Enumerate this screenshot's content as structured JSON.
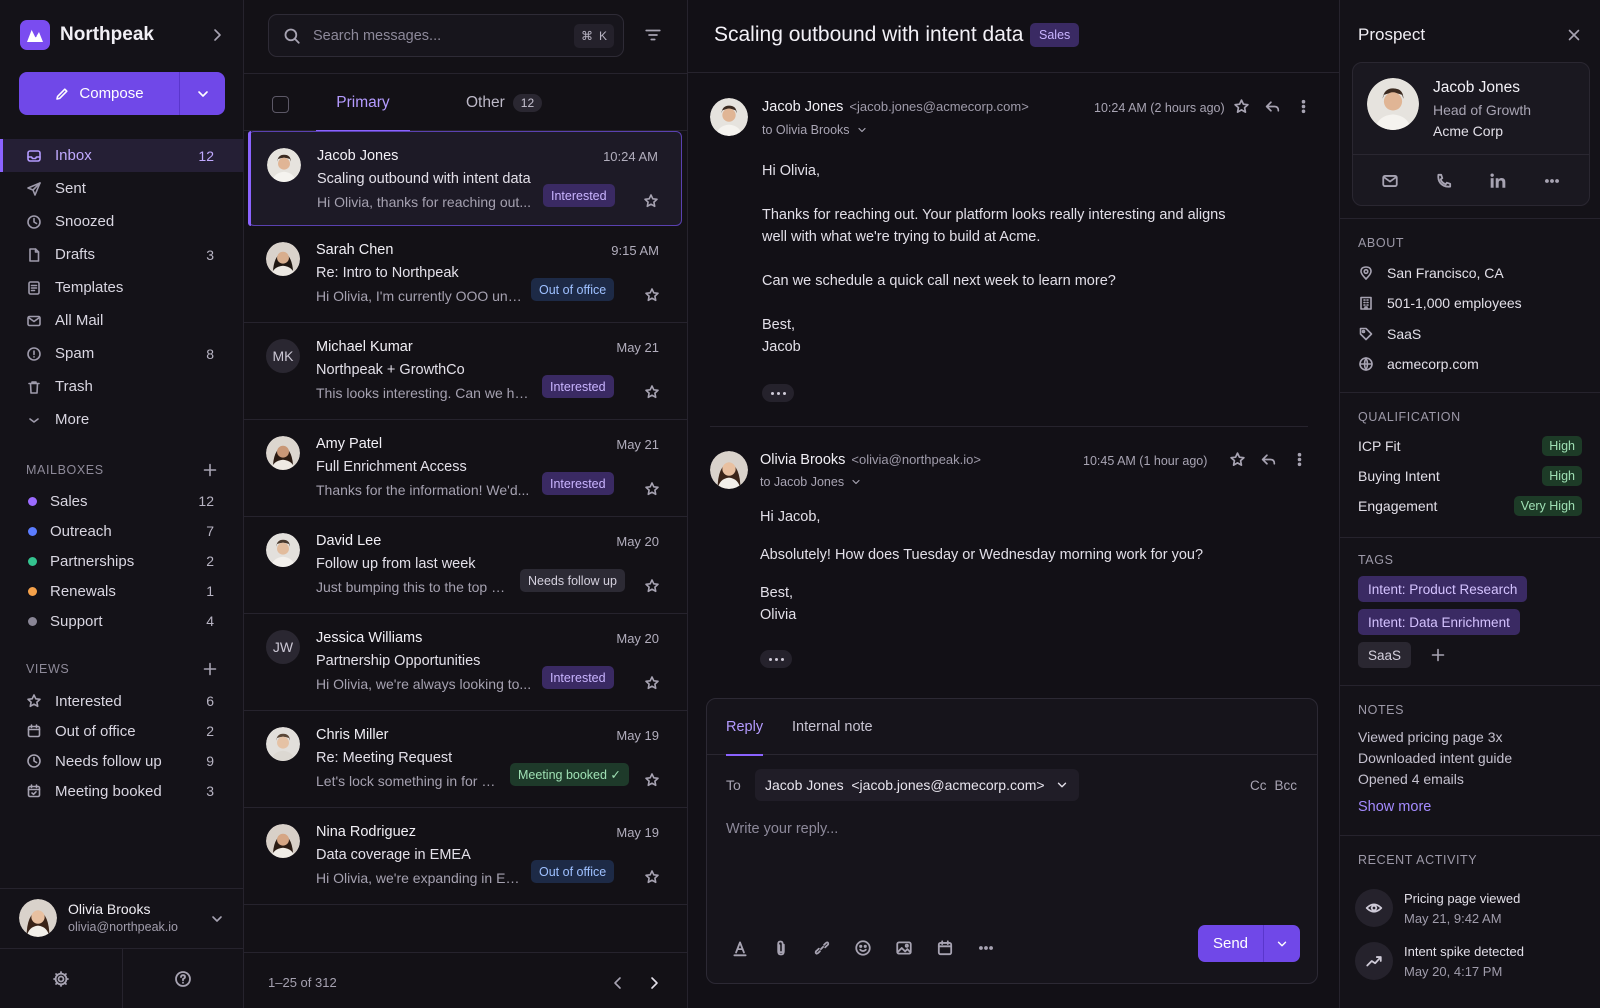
{
  "app": {
    "name": "Northpeak"
  },
  "compose_label": "Compose",
  "nav": [
    {
      "label": "Inbox",
      "count": "12"
    },
    {
      "label": "Sent",
      "count": ""
    },
    {
      "label": "Snoozed",
      "count": ""
    },
    {
      "label": "Drafts",
      "count": "3"
    },
    {
      "label": "Templates",
      "count": ""
    },
    {
      "label": "All Mail",
      "count": ""
    },
    {
      "label": "Spam",
      "count": "8"
    },
    {
      "label": "Trash",
      "count": ""
    },
    {
      "label": "More",
      "count": ""
    }
  ],
  "mailboxes": {
    "title": "MAILBOXES",
    "items": [
      {
        "label": "Sales",
        "count": "12",
        "color": "#9b6bff"
      },
      {
        "label": "Outreach",
        "count": "7",
        "color": "#5b7cff"
      },
      {
        "label": "Partnerships",
        "count": "2",
        "color": "#34c38f"
      },
      {
        "label": "Renewals",
        "count": "1",
        "color": "#f5a14a"
      },
      {
        "label": "Support",
        "count": "4",
        "color": "#8a8696"
      }
    ]
  },
  "views": {
    "title": "VIEWS",
    "items": [
      {
        "label": "Interested",
        "count": "6"
      },
      {
        "label": "Out of office",
        "count": "2"
      },
      {
        "label": "Needs follow up",
        "count": "9"
      },
      {
        "label": "Meeting booked",
        "count": "3"
      }
    ]
  },
  "user": {
    "name": "Olivia Brooks",
    "email": "olivia@northpeak.io"
  },
  "list": {
    "search_placeholder": "Search messages...",
    "shortcut_key1": "⌘",
    "shortcut_key2": "K",
    "tab_primary": "Primary",
    "tab_other": "Other",
    "tab_other_count": "12",
    "pagination": "1–25 of 312",
    "messages": [
      {
        "name": "Jacob Jones",
        "initials": "",
        "time": "10:24 AM",
        "subject": "Scaling outbound with intent data",
        "preview": "Hi Olivia, thanks for reaching out...",
        "badge": "Interested",
        "badge_type": "int"
      },
      {
        "name": "Sarah Chen",
        "initials": "",
        "time": "9:15 AM",
        "subject": "Re: Intro to Northpeak",
        "preview": "Hi Olivia, I'm currently OOO until...",
        "badge": "Out of office",
        "badge_type": "ooo"
      },
      {
        "name": "Michael Kumar",
        "initials": "MK",
        "time": "May 21",
        "subject": "Northpeak + GrowthCo",
        "preview": "This looks interesting. Can we hop...",
        "badge": "Interested",
        "badge_type": "int"
      },
      {
        "name": "Amy Patel",
        "initials": "",
        "time": "May 21",
        "subject": "Full Enrichment Access",
        "preview": "Thanks for the information! We'd...",
        "badge": "Interested",
        "badge_type": "int"
      },
      {
        "name": "David Lee",
        "initials": "",
        "time": "May 20",
        "subject": "Follow up from last week",
        "preview": "Just bumping this to the top of...",
        "badge": "Needs follow up",
        "badge_type": "nfu"
      },
      {
        "name": "Jessica Williams",
        "initials": "JW",
        "time": "May 20",
        "subject": "Partnership Opportunities",
        "preview": "Hi Olivia, we're always looking to...",
        "badge": "Interested",
        "badge_type": "int"
      },
      {
        "name": "Chris Miller",
        "initials": "",
        "time": "May 19",
        "subject": "Re: Meeting Request",
        "preview": "Let's lock something in for next...",
        "badge": "Meeting booked ✓",
        "badge_type": "mb"
      },
      {
        "name": "Nina Rodriguez",
        "initials": "",
        "time": "May 19",
        "subject": "Data coverage in EMEA",
        "preview": "Hi Olivia, we're expanding in EMEA...",
        "badge": "Out of office",
        "badge_type": "ooo"
      }
    ]
  },
  "thread": {
    "title": "Scaling outbound with intent data",
    "tag": "Sales",
    "messages": [
      {
        "from": "Jacob Jones",
        "addr": "<jacob.jones@acmecorp.com>",
        "to": "to Olivia Brooks",
        "time": "10:24 AM (2 hours ago)",
        "greeting": "Hi Olivia,",
        "p1": "Thanks for reaching out. Your platform looks really interesting and aligns well with what we're trying to build at Acme.",
        "p2": "Can we schedule a quick call next week to learn more?",
        "sign1": "Best,",
        "sign2": "Jacob"
      },
      {
        "from": "Olivia Brooks",
        "addr": "<olivia@northpeak.io>",
        "to": "to Jacob Jones",
        "time": "10:45 AM (1 hour ago)",
        "greeting": "Hi Jacob,",
        "p1": "Absolutely!  How does Tuesday or Wednesday morning work for you?",
        "sign1": "Best,",
        "sign2": "Olivia"
      }
    ],
    "reply": {
      "tab_reply": "Reply",
      "tab_note": "Internal note",
      "to_label": "To",
      "to_value": "Jacob Jones  <jacob.jones@acmecorp.com>",
      "cc": "Cc",
      "bcc": "Bcc",
      "placeholder": "Write your reply...",
      "send": "Send"
    }
  },
  "prospect": {
    "title": "Prospect",
    "name": "Jacob Jones",
    "role": "Head of Growth",
    "company": "Acme Corp",
    "about_title": "ABOUT",
    "about": [
      {
        "icon": "location-icon",
        "text": "San Francisco, CA"
      },
      {
        "icon": "building-icon",
        "text": "501-1,000 employees"
      },
      {
        "icon": "tag-icon",
        "text": "SaaS"
      },
      {
        "icon": "globe-icon",
        "text": "acmecorp.com"
      }
    ],
    "qual_title": "QUALIFICATION",
    "qualification": [
      {
        "label": "ICP Fit",
        "value": "High"
      },
      {
        "label": "Buying Intent",
        "value": "High"
      },
      {
        "label": "Engagement",
        "value": "Very High"
      }
    ],
    "tags_title": "TAGS",
    "tags": [
      "Intent: Product Research",
      "Intent: Data Enrichment",
      "SaaS"
    ],
    "notes_title": "NOTES",
    "notes": [
      "Viewed pricing page 3x",
      "Downloaded intent guide",
      "Opened 4 emails"
    ],
    "show_more": "Show more",
    "activity_title": "RECENT ACTIVITY",
    "activity": [
      {
        "icon": "eye-icon",
        "title": "Pricing page viewed",
        "date": "May 21, 9:42 AM"
      },
      {
        "icon": "trend-icon",
        "title": "Intent spike detected",
        "date": "May 20, 4:17 PM"
      }
    ]
  }
}
